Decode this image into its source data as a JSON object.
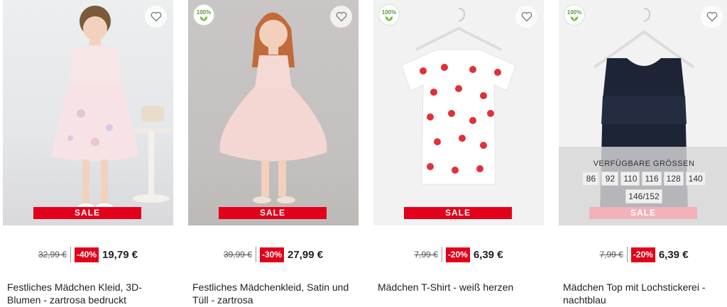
{
  "products": [
    {
      "old_price": "32,99 €",
      "discount": "-40%",
      "new_price": "19,79 €",
      "sale_label": "SALE",
      "name": "Festliches Mädchen Kleid, 3D-Blumen - zartrosa bedruckt"
    },
    {
      "badge_text": "100%",
      "old_price": "39,99 €",
      "discount": "-30%",
      "new_price": "27,99 €",
      "sale_label": "SALE",
      "name": "Festliches Mädchenkleid, Satin und Tüll - zartrosa"
    },
    {
      "badge_text": "100%",
      "old_price": "7,99 €",
      "discount": "-20%",
      "new_price": "6,39 €",
      "sale_label": "SALE",
      "name": "Mädchen T-Shirt - weiß herzen"
    },
    {
      "badge_text": "100%",
      "old_price": "7,99 €",
      "discount": "-20%",
      "new_price": "6,39 €",
      "sale_label": "SALE",
      "name": "Mädchen Top mit Lochstickerei - nachtblau",
      "sizes_title": "VERFÜGBARE GRÖSSEN",
      "sizes": [
        "86",
        "92",
        "110",
        "116",
        "128",
        "140",
        "146/152"
      ]
    }
  ],
  "colors": {
    "sale_red": "#e2001a",
    "bio_green": "#5a9b3c",
    "navy": "#1c2436"
  },
  "icons": {
    "wishlist": "heart-outline-icon",
    "bio": "bio-leaf-icon"
  }
}
